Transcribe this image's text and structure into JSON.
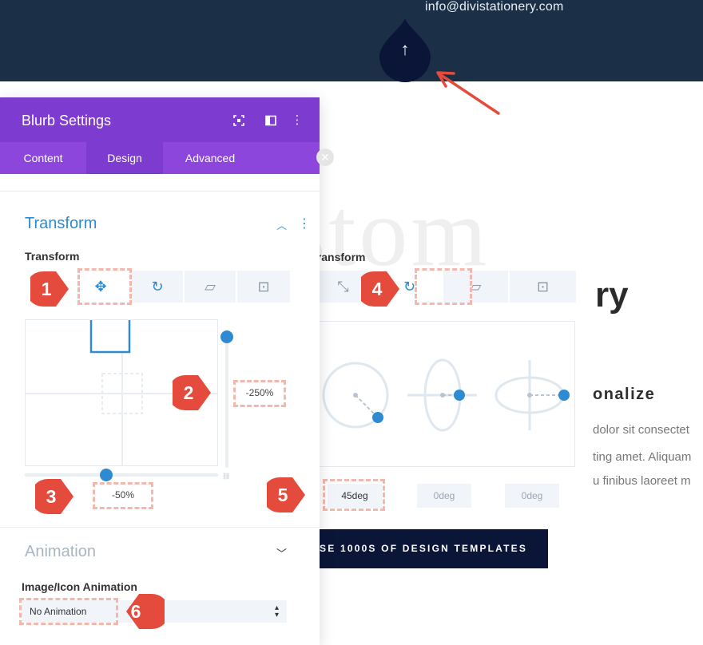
{
  "header": {
    "email": "info@divistationery.com",
    "back_to_top_icon": "arrow-up-icon"
  },
  "background_page": {
    "heading_partial": "stom",
    "subheading_partial": "ry",
    "section_heading_partial": "onalize",
    "paragraph_lines": [
      "dolor sit consectet",
      "ting amet. Aliquam",
      "u finibus laoreet m"
    ],
    "cta_label": "SE 1000S OF DESIGN TEMPLATES"
  },
  "panel": {
    "title": "Blurb Settings",
    "header_icons": [
      "fullscreen-icon",
      "split-view-icon",
      "more-vertical-icon"
    ],
    "tabs": [
      "Content",
      "Design",
      "Advanced"
    ],
    "active_tab": "Design",
    "transform_section": {
      "title": "Transform",
      "label": "Transform"
    },
    "translate": {
      "vertical_value": "-250%",
      "horizontal_value": "-50%"
    },
    "animation_section": {
      "title": "Animation"
    },
    "image_icon_animation": {
      "label": "Image/Icon Animation",
      "value": "No Animation"
    }
  },
  "rotate_panel": {
    "label": "Transform",
    "x_value": "45deg",
    "y_value": "0deg",
    "z_value": "0deg"
  },
  "callouts": [
    "1",
    "2",
    "3",
    "4",
    "5",
    "6"
  ],
  "colors": {
    "header_bg": "#1b2f47",
    "panel_purple": "#7e3bd0",
    "tab_purple": "#8d46dc",
    "accent_blue": "#2e8bd1",
    "callout_red": "#e54b3c",
    "highlight_dash": "#f4b7ae"
  }
}
